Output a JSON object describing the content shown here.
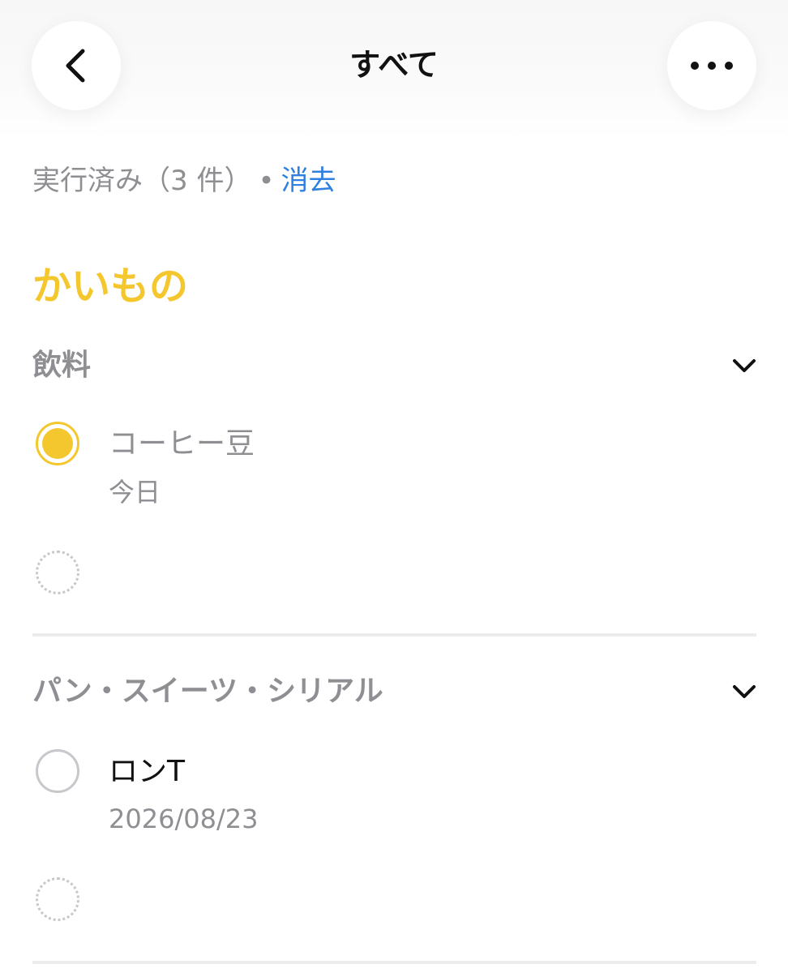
{
  "nav": {
    "title": "すべて",
    "back_icon": "chevron-left-icon",
    "more_icon": "ellipsis-icon"
  },
  "completed": {
    "label": "実行済み（3 件）",
    "separator": "•",
    "clear_label": "消去"
  },
  "list": {
    "title": "かいもの",
    "accent_color": "#f5c72e"
  },
  "sections": [
    {
      "label": "飲料",
      "items": [
        {
          "title": "コーヒー豆",
          "subtitle": "今日",
          "done": true
        }
      ]
    },
    {
      "label": "パン・スイーツ・シリアル",
      "items": [
        {
          "title": "ロンT",
          "subtitle": "2026/08/23",
          "done": false
        }
      ]
    }
  ],
  "colors": {
    "link": "#2f7fe0",
    "secondary_text": "#8e8e93",
    "primary_text": "#111111"
  }
}
